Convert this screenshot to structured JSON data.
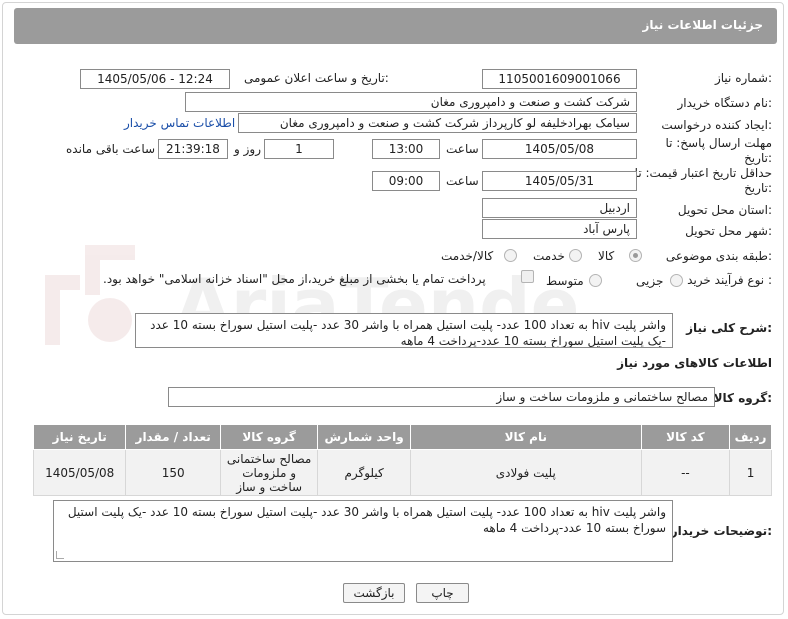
{
  "header": {
    "title": "جزئیات اطلاعات نیاز"
  },
  "fields": {
    "need_number_label": "شماره نیاز:",
    "need_number": "1105001609001066",
    "announce_label": "تاریخ و ساعت اعلان عمومی:",
    "announce_value": "1405/05/06 - 12:24",
    "buyer_org_label": "نام دستگاه خریدار:",
    "buyer_org": "شرکت کشت و صنعت و دامپروری مغان",
    "requester_label": "ایجاد کننده درخواست:",
    "requester": "سیامک بهرادخلیفه لو کارپرداز شرکت کشت و صنعت و دامپروری مغان",
    "contact_link": "اطلاعات تماس خریدار",
    "deadline_label": "مهلت ارسال پاسخ: تا تاریخ:",
    "deadline_date": "1405/05/08",
    "time_label": "ساعت",
    "deadline_time": "13:00",
    "days_value": "1",
    "days_label": "روز و",
    "remaining_time": "21:39:18",
    "remaining_label": "ساعت باقی مانده",
    "price_validity_label": "حداقل تاریخ اعتبار قیمت: تا تاریخ:",
    "price_date": "1405/05/31",
    "price_time_label": "ساعت",
    "price_time": "09:00",
    "province_label": "استان محل تحویل:",
    "province": "اردبیل",
    "city_label": "شهر محل تحویل:",
    "city": "پارس آباد",
    "category_label": "طبقه بندی موضوعی:",
    "category_options": [
      "کالا",
      "خدمت",
      "کالا/خدمت"
    ],
    "process_label": "نوع فرآیند خرید :",
    "process_options": [
      "جزیی",
      "متوسط"
    ],
    "payment_note": "پرداخت تمام یا بخشی از مبلغ خرید،از محل \"اسناد خزانه اسلامی\" خواهد بود."
  },
  "description": {
    "label": "شرح کلی نیاز:",
    "text": "واشر پلیت hiv به تعداد 100 عدد- پلیت استیل همراه با واشر 30 عدد -پلیت استیل سوراخ بسته 10 عدد -یک پلیت استیل سوراخ بسته 10 عدد-پرداخت 4 ماهه"
  },
  "goods_info_title": "اطلاعات کالاهای مورد نیاز",
  "goods_group": {
    "label": "گروه کالا:",
    "value": "مصالح ساختمانی و ملزومات ساخت و ساز"
  },
  "table": {
    "headers": [
      "ردیف",
      "کد کالا",
      "نام کالا",
      "واحد شمارش",
      "گروه کالا",
      "تعداد / مقدار",
      "تاریخ نیاز"
    ],
    "rows": [
      [
        "1",
        "--",
        "پلیت فولادی",
        "کیلوگرم",
        "مصالح ساختمانی و ملزومات ساخت و ساز",
        "150",
        "1405/05/08"
      ]
    ]
  },
  "buyer_notes": {
    "label": "توضیحات خریدار:",
    "text": "واشر پلیت hiv به تعداد 100 عدد- پلیت استیل همراه با واشر 30 عدد -پلیت استیل سوراخ بسته 10 عدد -یک پلیت استیل سوراخ بسته 10 عدد-پرداخت 4 ماهه"
  },
  "buttons": {
    "print": "چاپ",
    "back": "بازگشت"
  },
  "colors": {
    "header_bg": "#9b9b9b",
    "link": "#1a4ea8"
  }
}
